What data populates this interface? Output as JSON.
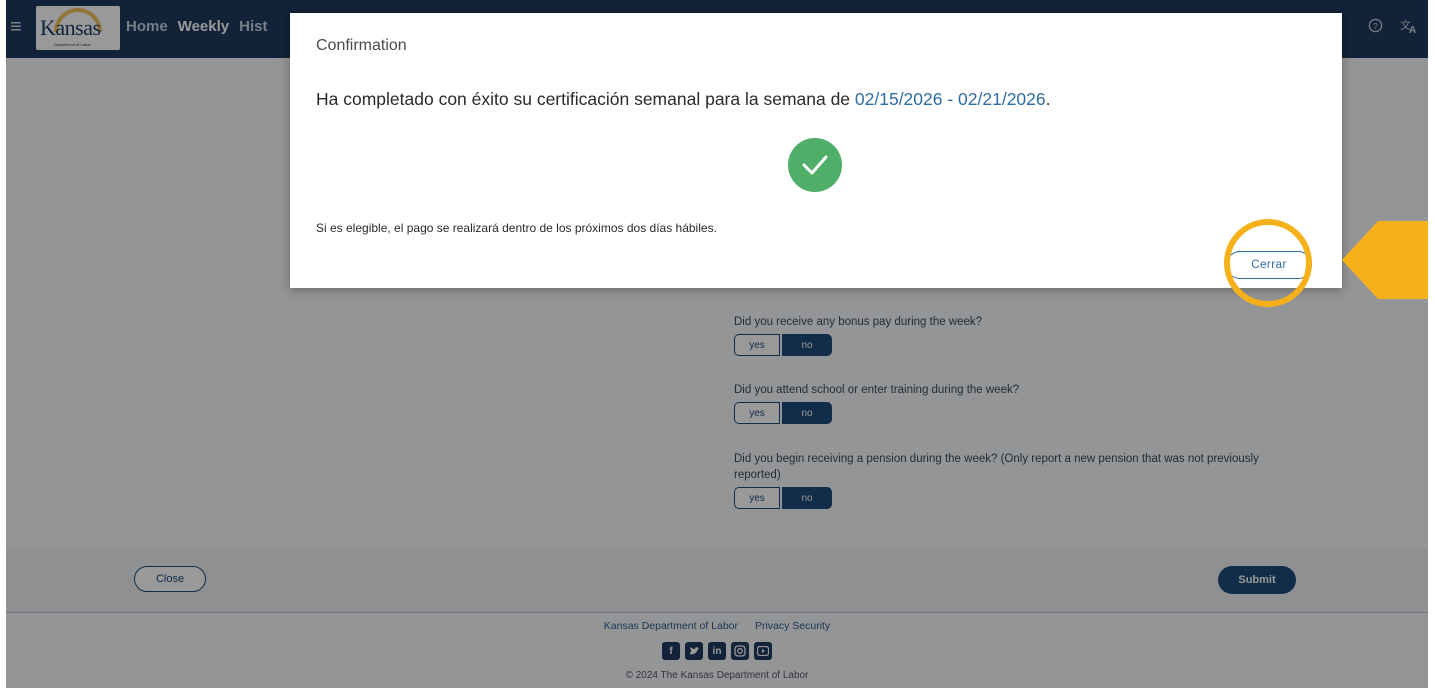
{
  "header": {
    "logo_text": "Kansas",
    "logo_subtext": "Department of Labor",
    "nav": [
      "Home",
      "Weekly",
      "Hist"
    ]
  },
  "form": {
    "questions": [
      {
        "text": "Did you receive any bonus pay during the week?",
        "yes": "yes",
        "no": "no",
        "selected": "no"
      },
      {
        "text": "Did you attend school or enter training during the week?",
        "yes": "yes",
        "no": "no",
        "selected": "no"
      },
      {
        "text": "Did you begin receiving a pension during the week? (Only report a new pension that was not previously reported)",
        "yes": "yes",
        "no": "no",
        "selected": "no"
      }
    ],
    "close_label": "Close",
    "submit_label": "Submit"
  },
  "footer": {
    "links": [
      "Kansas Department of Labor",
      "Privacy Security"
    ],
    "socials": [
      "facebook-icon",
      "twitter-icon",
      "linkedin-icon",
      "instagram-icon",
      "youtube-icon"
    ],
    "copyright": "© 2024 The Kansas Department of Labor"
  },
  "modal": {
    "title": "Confirmation",
    "message_prefix": "Ha completado con éxito su certificación semanal para la semana de ",
    "date_range": "02/15/2026 - 02/21/2026",
    "message_suffix": ".",
    "note": "Si es elegible, el pago se realizará dentro de los próximos dos días hábiles.",
    "close_label": "Cerrar"
  },
  "colors": {
    "header": "#1f3a5e",
    "primary": "#1f4b7a",
    "link": "#2e6ca6",
    "success": "#4fae68",
    "highlight": "#f6b11a"
  }
}
